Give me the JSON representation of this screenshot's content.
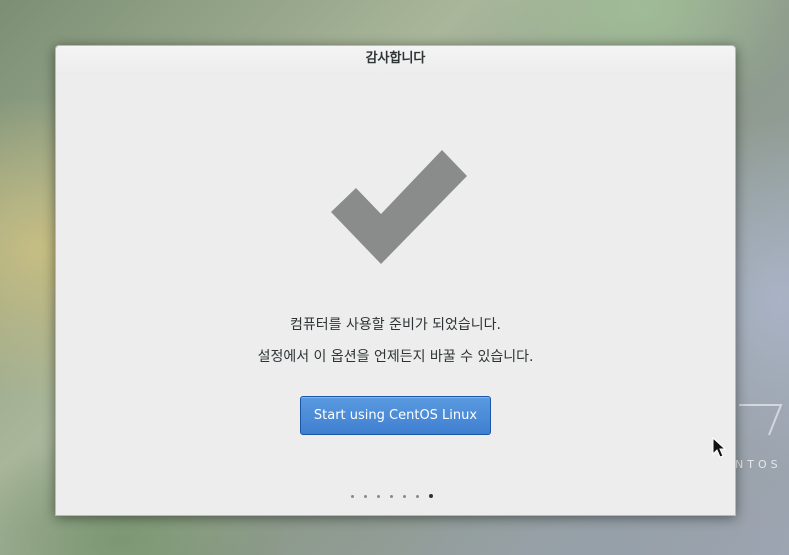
{
  "dialog": {
    "title": "감사합니다",
    "message_ready": "컴퓨터를 사용할 준비가 되었습니다.",
    "message_options": "설정에서 이 옵션을 언제든지 바꿀 수 있습니다.",
    "start_button_label": "Start using CentOS Linux",
    "icon": "checkmark-icon",
    "pager": {
      "total_pages": 7,
      "current_page": 7
    }
  },
  "desktop": {
    "brand_text": "NTOS"
  },
  "colors": {
    "dialog_background": "#ededed",
    "checkmark": "#8a8c8c",
    "button_blue": "#4a8ad8",
    "text": "#2e3436"
  }
}
